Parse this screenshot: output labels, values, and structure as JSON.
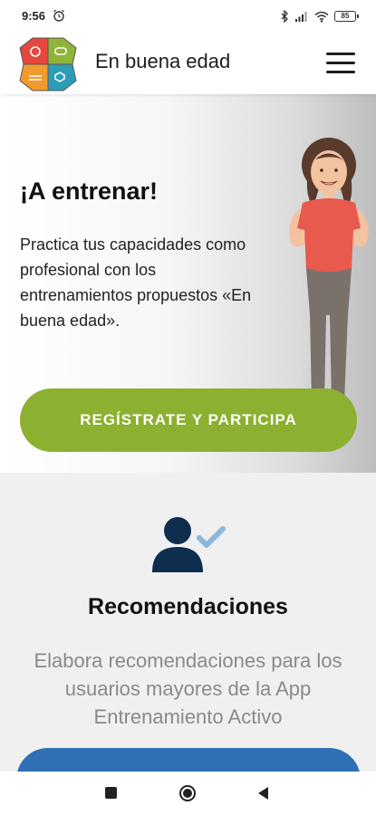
{
  "status_bar": {
    "time": "9:56",
    "battery": "85",
    "icons": [
      "alarm-icon",
      "bluetooth-icon",
      "signal-icon",
      "wifi-icon",
      "battery-icon"
    ]
  },
  "header": {
    "title": "En buena edad",
    "logo_colors": [
      "#e5473f",
      "#8fb43a",
      "#f29a2e",
      "#2b9db8"
    ],
    "menu_icon": "hamburger-menu-icon"
  },
  "hero": {
    "title": "¡A entrenar!",
    "text": "Practica tus capacidades como profesional con los entrenamientos propuestos «En buena edad».",
    "cta_label": "REGÍSTRATE Y PARTICIPA",
    "cta_color": "#8cb030"
  },
  "section": {
    "icon": "user-check-icon",
    "title": "Recomendaciones",
    "text": "Elabora recomendaciones para los usuarios mayores de la App Entrenamiento Activo",
    "button_color": "#2f6fb3"
  },
  "nav_bar": {
    "icons": [
      "recents-square-icon",
      "home-circle-icon",
      "back-triangle-icon"
    ]
  }
}
